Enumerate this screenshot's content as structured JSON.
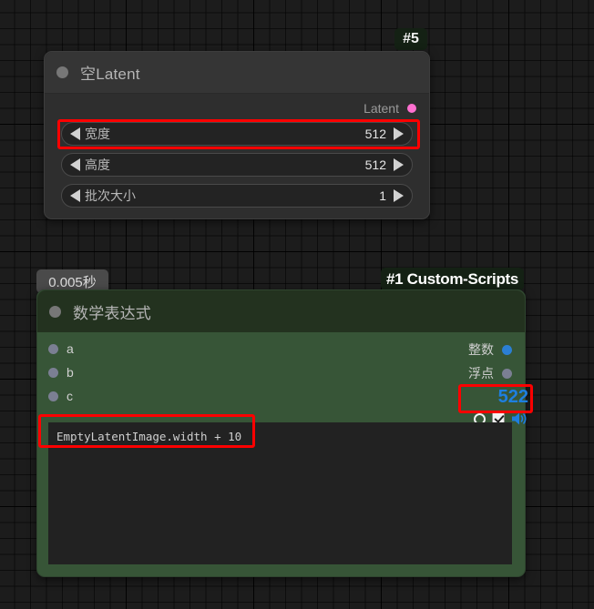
{
  "app": {
    "background": "#1c1c1c",
    "grid": "node-graph-canvas"
  },
  "badges": {
    "node5_id": "#5",
    "exec_time": "0.005秒",
    "custom_scripts": "#1 Custom-Scripts"
  },
  "nodes": [
    {
      "id": "empty-latent",
      "title": "空Latent",
      "title_color": "#353535",
      "body_color": "#2e2e2e",
      "outputs": [
        {
          "label": "Latent",
          "color": "#ff70d0"
        }
      ],
      "widgets": [
        {
          "name": "宽度",
          "value": "512",
          "left_arrow": "◀",
          "right_arrow": "▶"
        },
        {
          "name": "高度",
          "value": "512",
          "left_arrow": "◀",
          "right_arrow": "▶"
        },
        {
          "name": "批次大小",
          "value": "1",
          "left_arrow": "◀",
          "right_arrow": "▶"
        }
      ]
    },
    {
      "id": "math-expression",
      "title": "数学表达式",
      "title_color": "#23321f",
      "body_color": "#375537",
      "inputs": [
        {
          "label": "a",
          "color": "#7b7f93"
        },
        {
          "label": "b",
          "color": "#7b7f93"
        },
        {
          "label": "c",
          "color": "#7b7f93"
        }
      ],
      "outputs": [
        {
          "label": "整数",
          "color": "#2b7fd4"
        },
        {
          "label": "浮点",
          "color": "#7b7f93"
        }
      ],
      "expression": "EmptyLatentImage.width + 10",
      "result": "522",
      "result_color": "#1e7fe0",
      "controls": {
        "radio": "radio-unchecked",
        "checkbox": "checkbox-checked",
        "speaker": "speaker-on"
      }
    }
  ],
  "annotations": {
    "highlight_color": "#ff0000",
    "regions": [
      {
        "name": "width-widget",
        "target": "宽度 512"
      },
      {
        "name": "expression-field",
        "target": "EmptyLatentImage.width + 10"
      },
      {
        "name": "result-value",
        "target": "522"
      }
    ]
  }
}
